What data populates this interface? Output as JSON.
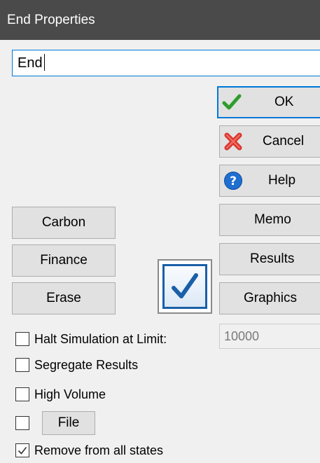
{
  "window": {
    "title": "End Properties"
  },
  "name_field": {
    "value": "End"
  },
  "buttons": {
    "ok": "OK",
    "cancel": "Cancel",
    "help": "Help",
    "memo": "Memo",
    "results": "Results",
    "graphics": "Graphics",
    "carbon": "Carbon",
    "finance": "Finance",
    "erase": "Erase",
    "file": "File"
  },
  "icons": {
    "ok": "checkmark-icon",
    "cancel": "red-x-icon",
    "help": "question-icon",
    "big_check": "checked-checkbox-icon"
  },
  "options": {
    "halt_simulation": {
      "label": "Halt Simulation at Limit:",
      "checked": false
    },
    "limit_value": "10000",
    "segregate_results": {
      "label": "Segregate Results",
      "checked": false
    },
    "high_volume": {
      "label": "High Volume",
      "checked": false
    },
    "file_enabled": {
      "checked": false
    },
    "remove_from_states": {
      "label": "Remove from all states",
      "checked": true
    }
  },
  "colors": {
    "title_bar": "#4a4a4a",
    "focus_blue": "#0078d7",
    "ok_green": "#2e9c2e",
    "cancel_red": "#d9342b",
    "help_blue": "#1f6fd1"
  }
}
